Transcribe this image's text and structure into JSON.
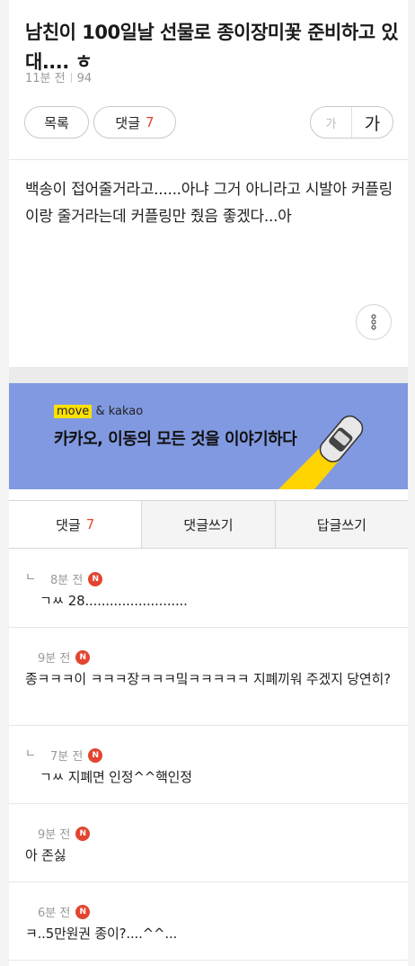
{
  "post": {
    "title": "남친이 100일날 선물로 종이장미꽃 준비하고 있대.... ㅎ",
    "time": "11분 전",
    "views": "94",
    "body": "백송이 접어줄거라고......아냐 그거 아니라고 시발아 커플링이랑 줄거라는데 커플링만 줬음 좋겠다...아"
  },
  "toolbar": {
    "list_label": "목록",
    "comment_label": "댓글",
    "comment_count": "7",
    "font_small": "가",
    "font_large": "가"
  },
  "banner": {
    "brand_move": "move",
    "brand_rest": " & kakao",
    "headline": "카카오, 이동의 모든 것을 이야기하다"
  },
  "tabs": [
    {
      "label": "댓글",
      "count": "7"
    },
    {
      "label": "댓글쓰기"
    },
    {
      "label": "답글쓰기"
    }
  ],
  "comments": [
    {
      "reply_mark": "ㄴ",
      "time": "8분 전",
      "badge": "N",
      "text": "ㄱㅆ 28........................."
    },
    {
      "time": "9분 전",
      "badge": "N",
      "text": "종ㅋㅋㅋ이 ㅋㅋㅋ장ㅋㅋㅋ밐ㅋㅋㅋㅋㅋ 지폐끼워 주겠지 당연히?"
    },
    {
      "reply_mark": "ㄴ",
      "time": "7분 전",
      "badge": "N",
      "text": "ㄱㅆ 지폐면 인정^^핵인정"
    },
    {
      "time": "9분 전",
      "badge": "N",
      "text": "아 존싫"
    },
    {
      "time": "6분 전",
      "badge": "N",
      "text": "ㅋ..5만원권 종이?....^^..."
    }
  ],
  "colors": {
    "accent": "#e2452f",
    "banner_bg": "#8199e0",
    "highlight": "#ffe100"
  },
  "icons": {
    "more": "vertical-dots-icon",
    "banner": "car-road-illustration"
  }
}
